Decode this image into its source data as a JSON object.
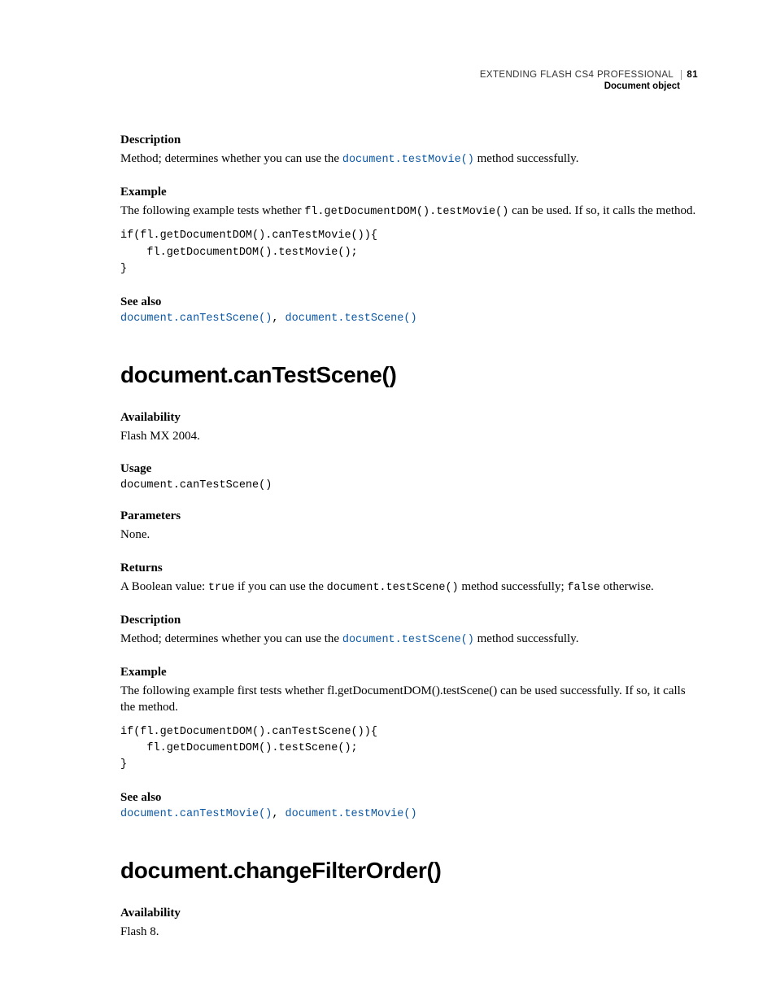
{
  "header": {
    "title": "EXTENDING FLASH CS4 PROFESSIONAL",
    "page_number": "81",
    "section": "Document object"
  },
  "s1": {
    "desc_h": "Description",
    "desc_pre": "Method; determines whether you can use the ",
    "desc_link": "document.testMovie()",
    "desc_post": " method successfully.",
    "ex_h": "Example",
    "ex_pre": "The following example tests whether ",
    "ex_code_inline": "fl.getDocumentDOM().testMovie()",
    "ex_post": " can be used. If so, it calls the method.",
    "code": "if(fl.getDocumentDOM().canTestMovie()){\n    fl.getDocumentDOM().testMovie();\n}",
    "also_h": "See also",
    "also_link1": "document.canTestScene()",
    "also_sep": ", ",
    "also_link2": "document.testScene()"
  },
  "s2": {
    "title": "document.canTestScene()",
    "avail_h": "Availability",
    "avail_v": "Flash MX 2004.",
    "usage_h": "Usage",
    "usage_v": "document.canTestScene()",
    "params_h": "Parameters",
    "params_v": "None.",
    "returns_h": "Returns",
    "returns_pre": "A Boolean value: ",
    "returns_true": "true",
    "returns_mid1": " if you can use the ",
    "returns_code": "document.testScene()",
    "returns_mid2": " method successfully; ",
    "returns_false": "false",
    "returns_post": " otherwise.",
    "desc_h": "Description",
    "desc_pre": "Method; determines whether you can use the ",
    "desc_link": "document.testScene()",
    "desc_post": " method successfully.",
    "ex_h": "Example",
    "ex_body": "The following example first tests whether fl.getDocumentDOM().testScene() can be used successfully. If so, it calls the method.",
    "code": "if(fl.getDocumentDOM().canTestScene()){\n    fl.getDocumentDOM().testScene();\n}",
    "also_h": "See also",
    "also_link1": "document.canTestMovie()",
    "also_sep": ", ",
    "also_link2": "document.testMovie()"
  },
  "s3": {
    "title": "document.changeFilterOrder()",
    "avail_h": "Availability",
    "avail_v": "Flash 8."
  }
}
